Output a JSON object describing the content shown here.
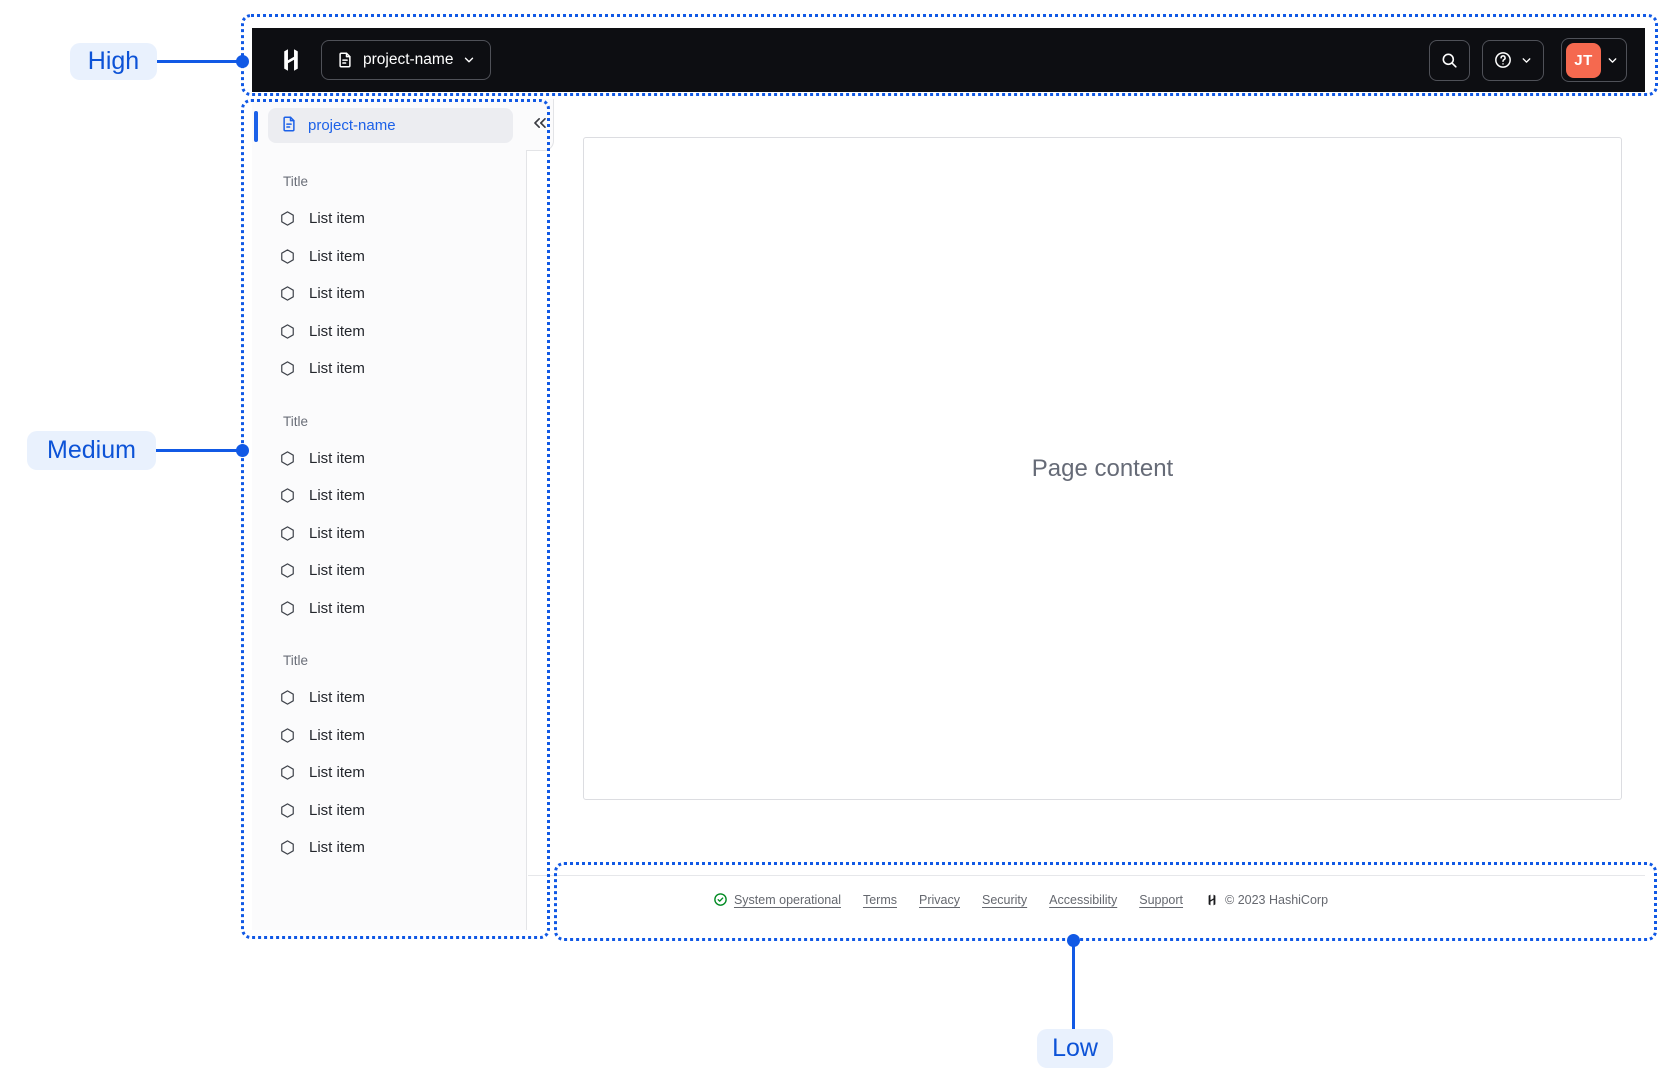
{
  "annotations": {
    "high_label": "High",
    "medium_label": "Medium",
    "low_label": "Low"
  },
  "navbar": {
    "project_switcher_label": "project-name"
  },
  "user": {
    "initials": "JT"
  },
  "sidebar": {
    "active_item_label": "project-name",
    "groups": [
      {
        "title": "Title",
        "items": [
          "List item",
          "List item",
          "List item",
          "List item",
          "List item"
        ]
      },
      {
        "title": "Title",
        "items": [
          "List item",
          "List item",
          "List item",
          "List item",
          "List item"
        ]
      },
      {
        "title": "Title",
        "items": [
          "List item",
          "List item",
          "List item",
          "List item",
          "List item"
        ]
      }
    ]
  },
  "main": {
    "placeholder": "Page content"
  },
  "footer": {
    "status_label": "System operational",
    "links": [
      "Terms",
      "Privacy",
      "Security",
      "Accessibility",
      "Support"
    ],
    "copyright": "© 2023 HashiCorp"
  },
  "colors": {
    "annotation_blue": "#1159E5",
    "avatar_orange": "#F5694F",
    "success_green": "#008A22",
    "navbar_black": "#0D0E12",
    "sidebar_link_blue": "#1C61E8"
  }
}
